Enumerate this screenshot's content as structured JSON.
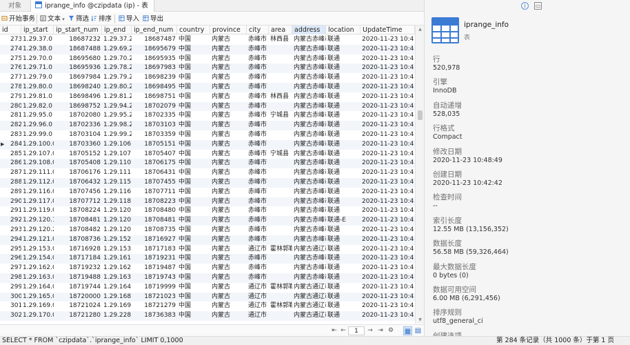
{
  "tabs": {
    "objects": "对象",
    "active": "iprange_info @czipdata (ip) - 表"
  },
  "toolbar": {
    "begin_transaction": "开始事务",
    "text": "文本",
    "filter": "筛选",
    "sort": "排序",
    "import": "导入",
    "export": "导出"
  },
  "columns": [
    "id",
    "ip_start",
    "ip_start_num",
    "ip_end",
    "ip_end_num",
    "country",
    "province",
    "city",
    "area",
    "address",
    "location",
    "UpdateTime"
  ],
  "rows": [
    [
      "273",
      "1.29.37.0",
      "18687232",
      "1.29.37.25",
      "18687487",
      "中国",
      "内蒙古",
      "赤峰市",
      "林西县",
      "内蒙古赤峰市",
      "联通",
      "2020-11-23 10:4"
    ],
    [
      "274",
      "1.29.38.0",
      "18687488",
      "1.29.69.25",
      "18695679",
      "中国",
      "内蒙古",
      "赤峰市",
      "",
      "内蒙古赤峰市",
      "联通",
      "2020-11-23 10:4"
    ],
    [
      "275",
      "1.29.70.0",
      "18695680",
      "1.29.70.25",
      "18695935",
      "中国",
      "内蒙古",
      "赤峰市",
      "",
      "内蒙古赤峰市",
      "联通",
      "2020-11-23 10:4"
    ],
    [
      "276",
      "1.29.71.0",
      "18695936",
      "1.29.78.25",
      "18697983",
      "中国",
      "内蒙古",
      "赤峰市",
      "",
      "内蒙古赤峰市",
      "联通",
      "2020-11-23 10:4"
    ],
    [
      "277",
      "1.29.79.0",
      "18697984",
      "1.29.79.25",
      "18698239",
      "中国",
      "内蒙古",
      "赤峰市",
      "",
      "内蒙古赤峰市",
      "联通",
      "2020-11-23 10:4"
    ],
    [
      "278",
      "1.29.80.0",
      "18698240",
      "1.29.80.25",
      "18698495",
      "中国",
      "内蒙古",
      "赤峰市",
      "",
      "内蒙古赤峰市",
      "联通",
      "2020-11-23 10:4"
    ],
    [
      "279",
      "1.29.81.0",
      "18698496",
      "1.29.81.25",
      "18698751",
      "中国",
      "内蒙古",
      "赤峰市",
      "林西县",
      "内蒙古赤峰市",
      "联通",
      "2020-11-23 10:4"
    ],
    [
      "280",
      "1.29.82.0",
      "18698752",
      "1.29.94.25",
      "18702079",
      "中国",
      "内蒙古",
      "赤峰市",
      "",
      "内蒙古赤峰市",
      "联通",
      "2020-11-23 10:4"
    ],
    [
      "281",
      "1.29.95.0",
      "18702080",
      "1.29.95.25",
      "18702335",
      "中国",
      "内蒙古",
      "赤峰市",
      "宁城县",
      "内蒙古赤峰市",
      "联通",
      "2020-11-23 10:4"
    ],
    [
      "282",
      "1.29.96.0",
      "18702336",
      "1.29.98.25",
      "18703103",
      "中国",
      "内蒙古",
      "赤峰市",
      "",
      "内蒙古赤峰市",
      "联通",
      "2020-11-23 10:4"
    ],
    [
      "283",
      "1.29.99.0",
      "18703104",
      "1.29.99.25",
      "18703359",
      "中国",
      "内蒙古",
      "赤峰市",
      "",
      "内蒙古赤峰市",
      "联通",
      "2020-11-23 10:4"
    ],
    [
      "284",
      "1.29.100.0",
      "18703360",
      "1.29.106.2",
      "18705151",
      "中国",
      "内蒙古",
      "赤峰市",
      "",
      "内蒙古赤峰市",
      "联通",
      "2020-11-23 10:4"
    ],
    [
      "285",
      "1.29.107.0",
      "18705152",
      "1.29.107.2",
      "18705407",
      "中国",
      "内蒙古",
      "赤峰市",
      "宁城县",
      "内蒙古赤峰市",
      "联通",
      "2020-11-23 10:4"
    ],
    [
      "286",
      "1.29.108.0",
      "18705408",
      "1.29.110.2",
      "18706175",
      "中国",
      "内蒙古",
      "赤峰市",
      "",
      "内蒙古赤峰市",
      "联通",
      "2020-11-23 10:4"
    ],
    [
      "287",
      "1.29.111.0",
      "18706176",
      "1.29.111.2",
      "18706431",
      "中国",
      "内蒙古",
      "赤峰市",
      "",
      "内蒙古赤峰市",
      "联通",
      "2020-11-23 10:4"
    ],
    [
      "288",
      "1.29.112.0",
      "18706432",
      "1.29.115.2",
      "18707455",
      "中国",
      "内蒙古",
      "赤峰市",
      "",
      "内蒙古赤峰市",
      "联通",
      "2020-11-23 10:4"
    ],
    [
      "289",
      "1.29.116.0",
      "18707456",
      "1.29.116.2",
      "18707711",
      "中国",
      "内蒙古",
      "赤峰市",
      "",
      "内蒙古赤峰市",
      "联通",
      "2020-11-23 10:4"
    ],
    [
      "290",
      "1.29.117.0",
      "18707712",
      "1.29.118.2",
      "18708223",
      "中国",
      "内蒙古",
      "赤峰市",
      "",
      "内蒙古赤峰市",
      "联通",
      "2020-11-23 10:4"
    ],
    [
      "291",
      "1.29.119.0",
      "18708224",
      "1.29.120.0",
      "18708480",
      "中国",
      "内蒙古",
      "赤峰市",
      "",
      "内蒙古赤峰市",
      "联通",
      "2020-11-23 10:4"
    ],
    [
      "292",
      "1.29.120.1",
      "18708481",
      "1.29.120.1",
      "18708481",
      "中国",
      "内蒙古",
      "赤峰市",
      "",
      "内蒙古赤峰市林东镇",
      "联通-E",
      "2020-11-23 10:4"
    ],
    [
      "293",
      "1.29.120.2",
      "18708482",
      "1.29.120.2",
      "18708735",
      "中国",
      "内蒙古",
      "赤峰市",
      "",
      "内蒙古赤峰市",
      "联通",
      "2020-11-23 10:4"
    ],
    [
      "294",
      "1.29.121.0",
      "18708736",
      "1.29.152.2",
      "18716927",
      "中国",
      "内蒙古",
      "赤峰市",
      "",
      "内蒙古赤峰市",
      "联通",
      "2020-11-23 10:4"
    ],
    [
      "295",
      "1.29.153.0",
      "18716928",
      "1.29.153.2",
      "18717183",
      "中国",
      "内蒙古",
      "通辽市",
      "霍林郭勒",
      "内蒙古通辽市",
      "联通",
      "2020-11-23 10:4"
    ],
    [
      "296",
      "1.29.154.0",
      "18717184",
      "1.29.161.2",
      "18719231",
      "中国",
      "内蒙古",
      "赤峰市",
      "",
      "内蒙古赤峰市",
      "联通",
      "2020-11-23 10:4"
    ],
    [
      "297",
      "1.29.162.0",
      "18719232",
      "1.29.162.2",
      "18719487",
      "中国",
      "内蒙古",
      "赤峰市",
      "",
      "内蒙古赤峰市",
      "联通",
      "2020-11-23 10:4"
    ],
    [
      "298",
      "1.29.163.0",
      "18719488",
      "1.29.163.2",
      "18719743",
      "中国",
      "内蒙古",
      "赤峰市",
      "",
      "内蒙古赤峰市",
      "联通",
      "2020-11-23 10:4"
    ],
    [
      "299",
      "1.29.164.0",
      "18719744",
      "1.29.164.2",
      "18719999",
      "中国",
      "内蒙古",
      "通辽市",
      "霍林郭勒",
      "内蒙古通辽市",
      "联通",
      "2020-11-23 10:4"
    ],
    [
      "300",
      "1.29.165.0",
      "18720000",
      "1.29.168.2",
      "18721023",
      "中国",
      "内蒙古",
      "通辽市",
      "",
      "内蒙古通辽市",
      "联通",
      "2020-11-23 10:4"
    ],
    [
      "301",
      "1.29.169.0",
      "18721024",
      "1.29.169.2",
      "18721279",
      "中国",
      "内蒙古",
      "通辽市",
      "霍林郭勒",
      "内蒙古通辽市",
      "联通",
      "2020-11-23 10:4"
    ],
    [
      "302",
      "1.29.170.0",
      "18721280",
      "1.29.228.2",
      "18736383",
      "中国",
      "内蒙古",
      "通辽市",
      "",
      "内蒙古通辽市",
      "联通",
      "2020-11-23 10:4"
    ]
  ],
  "current_row_index": 11,
  "navigation": {
    "page": "1"
  },
  "statusbar": {
    "sql": "SELECT * FROM `czipdata`.`iprange_info` LIMIT 0,1000",
    "record": "第 284 条记录（共 1000 条）于第 1 页"
  },
  "info_panel": {
    "table_name": "iprange_info",
    "table_type": "表",
    "props": [
      {
        "label": "行",
        "value": "520,978"
      },
      {
        "label": "引擎",
        "value": "InnoDB"
      },
      {
        "label": "自动递增",
        "value": "528,035"
      },
      {
        "label": "行格式",
        "value": "Compact"
      },
      {
        "label": "修改日期",
        "value": "2020-11-23 10:48:49"
      },
      {
        "label": "创建日期",
        "value": "2020-11-23 10:42:42"
      },
      {
        "label": "检查时间",
        "value": "--"
      },
      {
        "label": "索引长度",
        "value": "12.55 MB (13,156,352)"
      },
      {
        "label": "数据长度",
        "value": "56.58 MB (59,326,464)"
      },
      {
        "label": "最大数据长度",
        "value": "0 bytes (0)"
      },
      {
        "label": "数据可用空间",
        "value": "6.00 MB (6,291,456)"
      },
      {
        "label": "排序规则",
        "value": "utf8_general_ci"
      },
      {
        "label": "创建选项",
        "value": ""
      }
    ]
  },
  "colors": {
    "accent": "#3b7bd4",
    "row_alt": "#f2f6fb",
    "selected_header": "#dde9f8"
  }
}
